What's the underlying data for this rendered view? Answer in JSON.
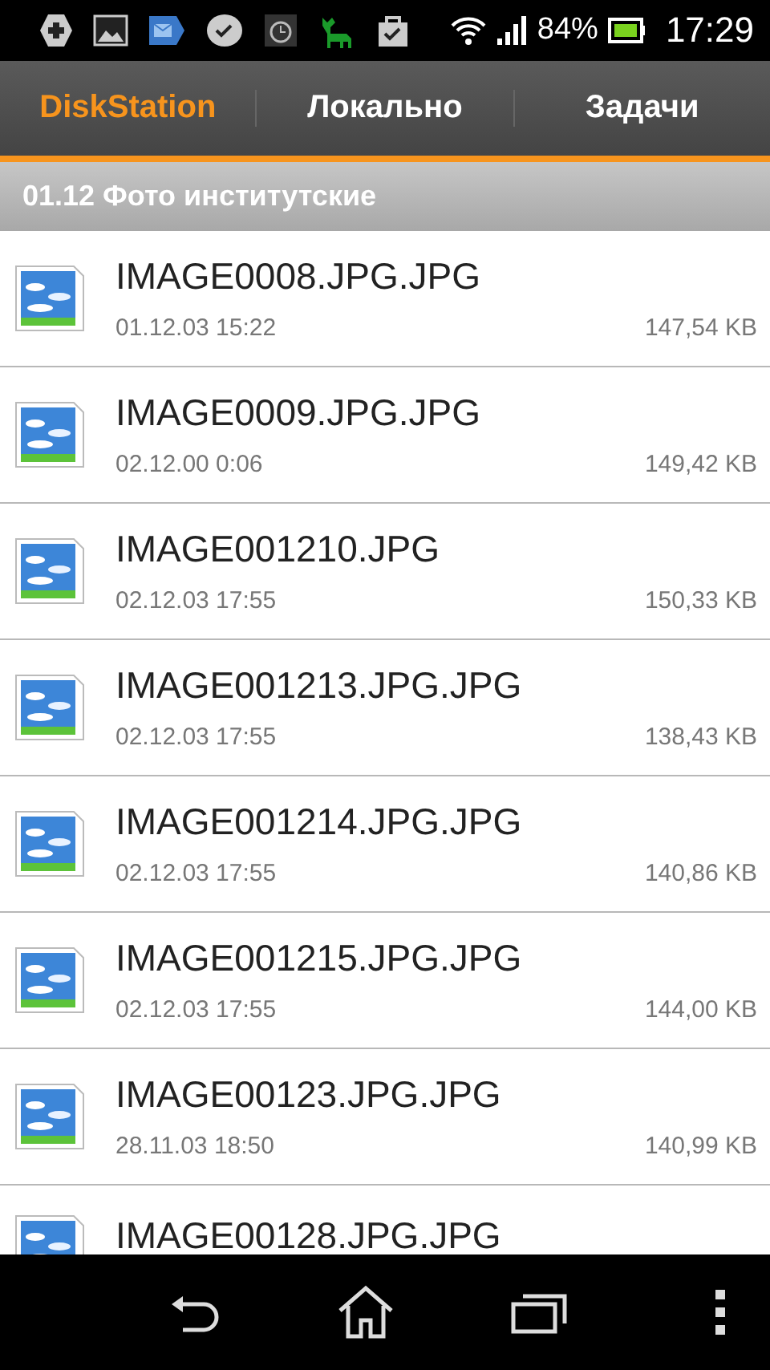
{
  "status_bar": {
    "battery": "84%",
    "time": "17:29"
  },
  "tabs": [
    {
      "label": "DiskStation",
      "selected": true
    },
    {
      "label": "Локально",
      "selected": false
    },
    {
      "label": "Задачи",
      "selected": false
    }
  ],
  "folder": {
    "title": "01.12 Фото институтские"
  },
  "files": [
    {
      "name": "IMAGE0008.JPG.JPG",
      "date": "01.12.03 15:22",
      "size": "147,54 KB"
    },
    {
      "name": "IMAGE0009.JPG.JPG",
      "date": "02.12.00 0:06",
      "size": "149,42 KB"
    },
    {
      "name": "IMAGE001210.JPG",
      "date": "02.12.03 17:55",
      "size": "150,33 KB"
    },
    {
      "name": "IMAGE001213.JPG.JPG",
      "date": "02.12.03 17:55",
      "size": "138,43 KB"
    },
    {
      "name": "IMAGE001214.JPG.JPG",
      "date": "02.12.03 17:55",
      "size": "140,86 KB"
    },
    {
      "name": "IMAGE001215.JPG.JPG",
      "date": "02.12.03 17:55",
      "size": "144,00 KB"
    },
    {
      "name": "IMAGE00123.JPG.JPG",
      "date": "28.11.03 18:50",
      "size": "140,99 KB"
    },
    {
      "name": "IMAGE00128.JPG.JPG"
    }
  ]
}
